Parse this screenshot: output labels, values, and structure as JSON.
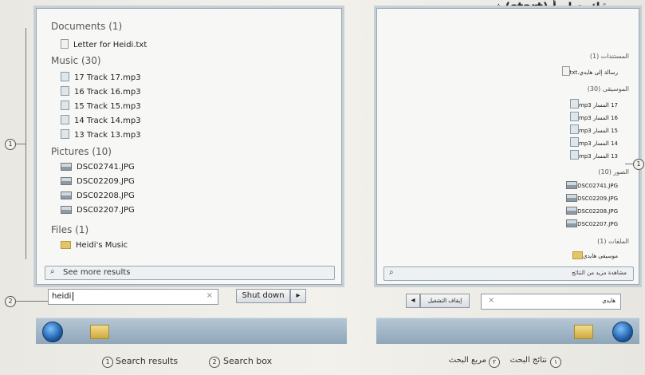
{
  "header": {
    "arabic_title": "من قائمة ابدأ (start) ثم"
  },
  "left_menu": {
    "sections": [
      {
        "title": "Documents (1)",
        "items": [
          "Letter for Heidi.txt"
        ]
      },
      {
        "title": "Music (30)",
        "items": [
          "17 Track 17.mp3",
          "16 Track 16.mp3",
          "15 Track 15.mp3",
          "14 Track 14.mp3",
          "13 Track 13.mp3"
        ]
      },
      {
        "title": "Pictures (10)",
        "items": [
          "DSC02741.JPG",
          "DSC02209.JPG",
          "DSC02208.JPG",
          "DSC02207.JPG"
        ]
      },
      {
        "title": "Files (1)",
        "items": [
          "Heidi's Music"
        ]
      }
    ],
    "see_more": "See more results",
    "search_value": "heidi",
    "clear_glyph": "×",
    "shutdown_label": "Shut down",
    "arrow_glyph": "▸"
  },
  "right_menu": {
    "sections": [
      {
        "title": "المستندات (1)",
        "items": [
          "رسالة إلى هايدي.txt"
        ]
      },
      {
        "title": "الموسيقى (30)",
        "items": [
          "17 المسار mp3",
          "16 المسار mp3",
          "15 المسار mp3",
          "14 المسار mp3",
          "13 المسار mp3"
        ]
      },
      {
        "title": "الصور (10)",
        "items": [
          "DSC02741.JPG",
          "DSC02209.JPG",
          "DSC02208.JPG",
          "DSC02207.JPG"
        ]
      },
      {
        "title": "الملفات (1)",
        "items": [
          "موسيقى هايدي"
        ]
      }
    ],
    "see_more": "مشاهدة مزيد من النتائج",
    "search_value": "هايدي",
    "clear_glyph": "×",
    "shutdown_label": "إيقاف التشغيل",
    "arrow_glyph": "◂"
  },
  "callouts": {
    "one": "1",
    "two": "2",
    "right_one": "1"
  },
  "captions": {
    "en": {
      "c1_num": "1",
      "c1_text": "Search results",
      "c2_num": "2",
      "c2_text": "Search box"
    },
    "ar": {
      "c1_num": "١",
      "c1_text": "نتائج البحث",
      "c2_num": "٢",
      "c2_text": "مربع البحث"
    }
  }
}
